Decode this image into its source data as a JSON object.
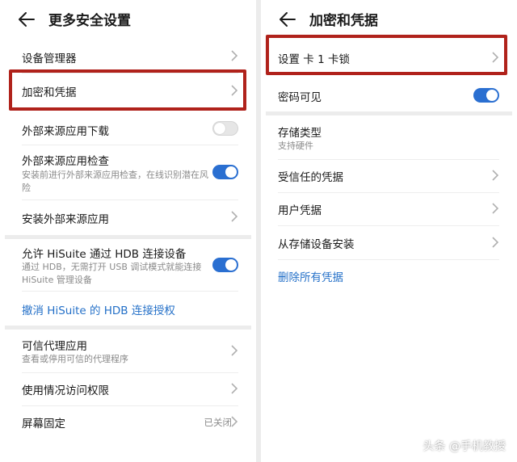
{
  "colors": {
    "accent": "#2a6fd1",
    "link": "#2470c8",
    "highlight_box": "#b0221b"
  },
  "left": {
    "title": "更多安全设置",
    "items": [
      {
        "label": "设备管理器"
      },
      {
        "label": "加密和凭据"
      },
      {
        "label": "外部来源应用下载",
        "toggle": false
      },
      {
        "label": "外部来源应用检查",
        "sub": "安装前进行外部来源应用检查，在线识别潜在风险",
        "toggle": true
      },
      {
        "label": "安装外部来源应用"
      },
      {
        "label": "允许 HiSuite 通过 HDB 连接设备",
        "sub": "通过 HDB，无需打开 USB 调试模式就能连接 HiSuite 管理设备",
        "toggle": true
      },
      {
        "link": "撤消 HiSuite 的 HDB 连接授权"
      },
      {
        "label": "可信代理应用",
        "sub": "查看或停用可信的代理程序"
      },
      {
        "label": "使用情况访问权限"
      },
      {
        "label": "屏幕固定",
        "hint": "已关闭"
      }
    ]
  },
  "right": {
    "title": "加密和凭据",
    "items": [
      {
        "label": "设置 卡 1 卡锁"
      },
      {
        "label": "密码可见",
        "toggle": true
      },
      {
        "label": "存储类型",
        "sub": "支持硬件"
      },
      {
        "label": "受信任的凭据"
      },
      {
        "label": "用户凭据"
      },
      {
        "label": "从存储设备安装"
      },
      {
        "link": "删除所有凭据"
      }
    ]
  },
  "watermark": "头条 @手机教授"
}
